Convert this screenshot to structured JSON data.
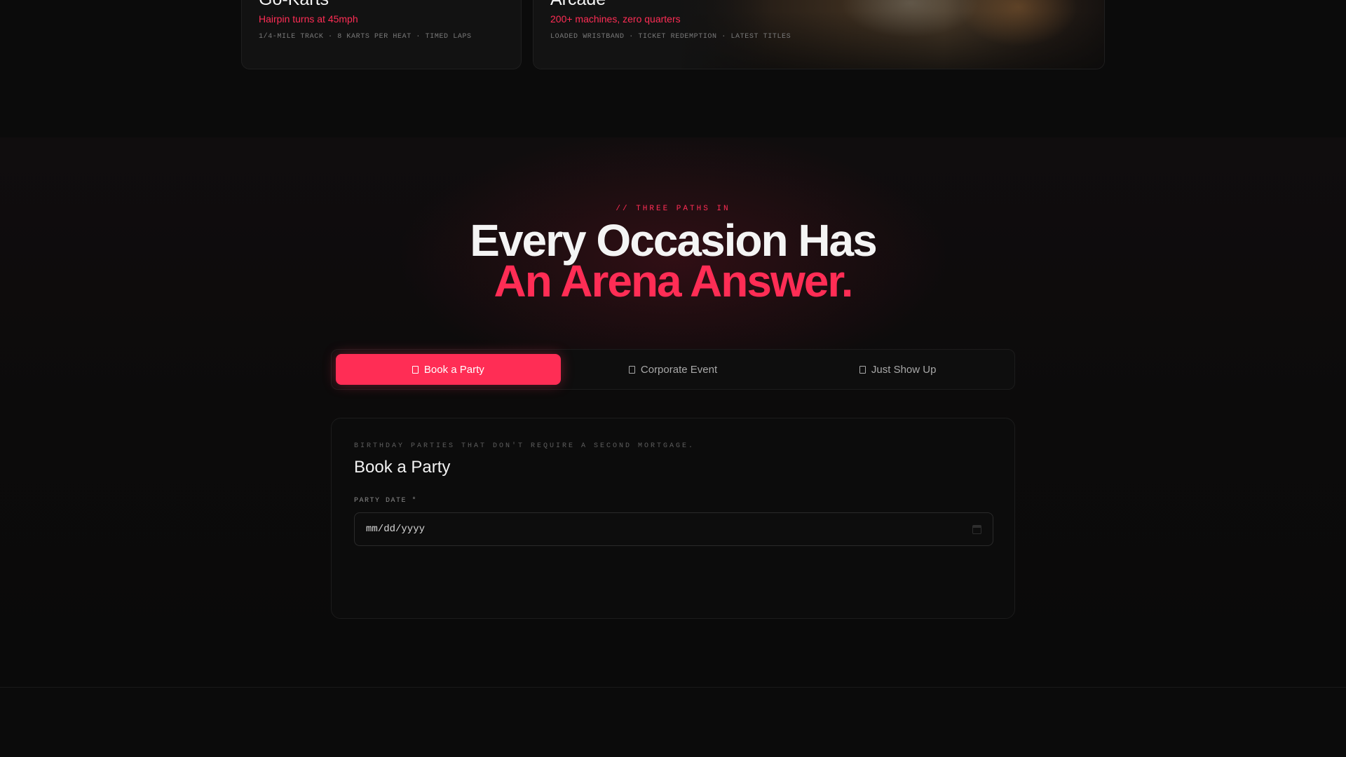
{
  "cards": [
    {
      "title": "Go-Karts",
      "subtitle": "Hairpin turns at 45mph",
      "meta": "1/4-MILE TRACK · 8 KARTS PER HEAT · TIMED LAPS"
    },
    {
      "title": "Arcade",
      "subtitle": "200+ machines, zero quarters",
      "meta": "LOADED WRISTBAND · TICKET REDEMPTION · LATEST TITLES"
    }
  ],
  "section": {
    "eyebrow": "// THREE PATHS IN",
    "headline_line1": "Every Occasion Has",
    "headline_line2": "An Arena Answer."
  },
  "tabs": [
    {
      "label": "Book a Party",
      "icon": "party-icon",
      "active": true
    },
    {
      "label": "Corporate Event",
      "icon": "briefcase-icon",
      "active": false
    },
    {
      "label": "Just Show Up",
      "icon": "ticket-icon",
      "active": false
    }
  ],
  "panel": {
    "eyebrow": "BIRTHDAY PARTIES THAT DON'T REQUIRE A SECOND MORTGAGE.",
    "title": "Book a Party",
    "field_label": "PARTY DATE *",
    "date_placeholder": "mm/dd/yyyy"
  },
  "colors": {
    "accent": "#ff2d55",
    "background": "#0a0a0a"
  }
}
